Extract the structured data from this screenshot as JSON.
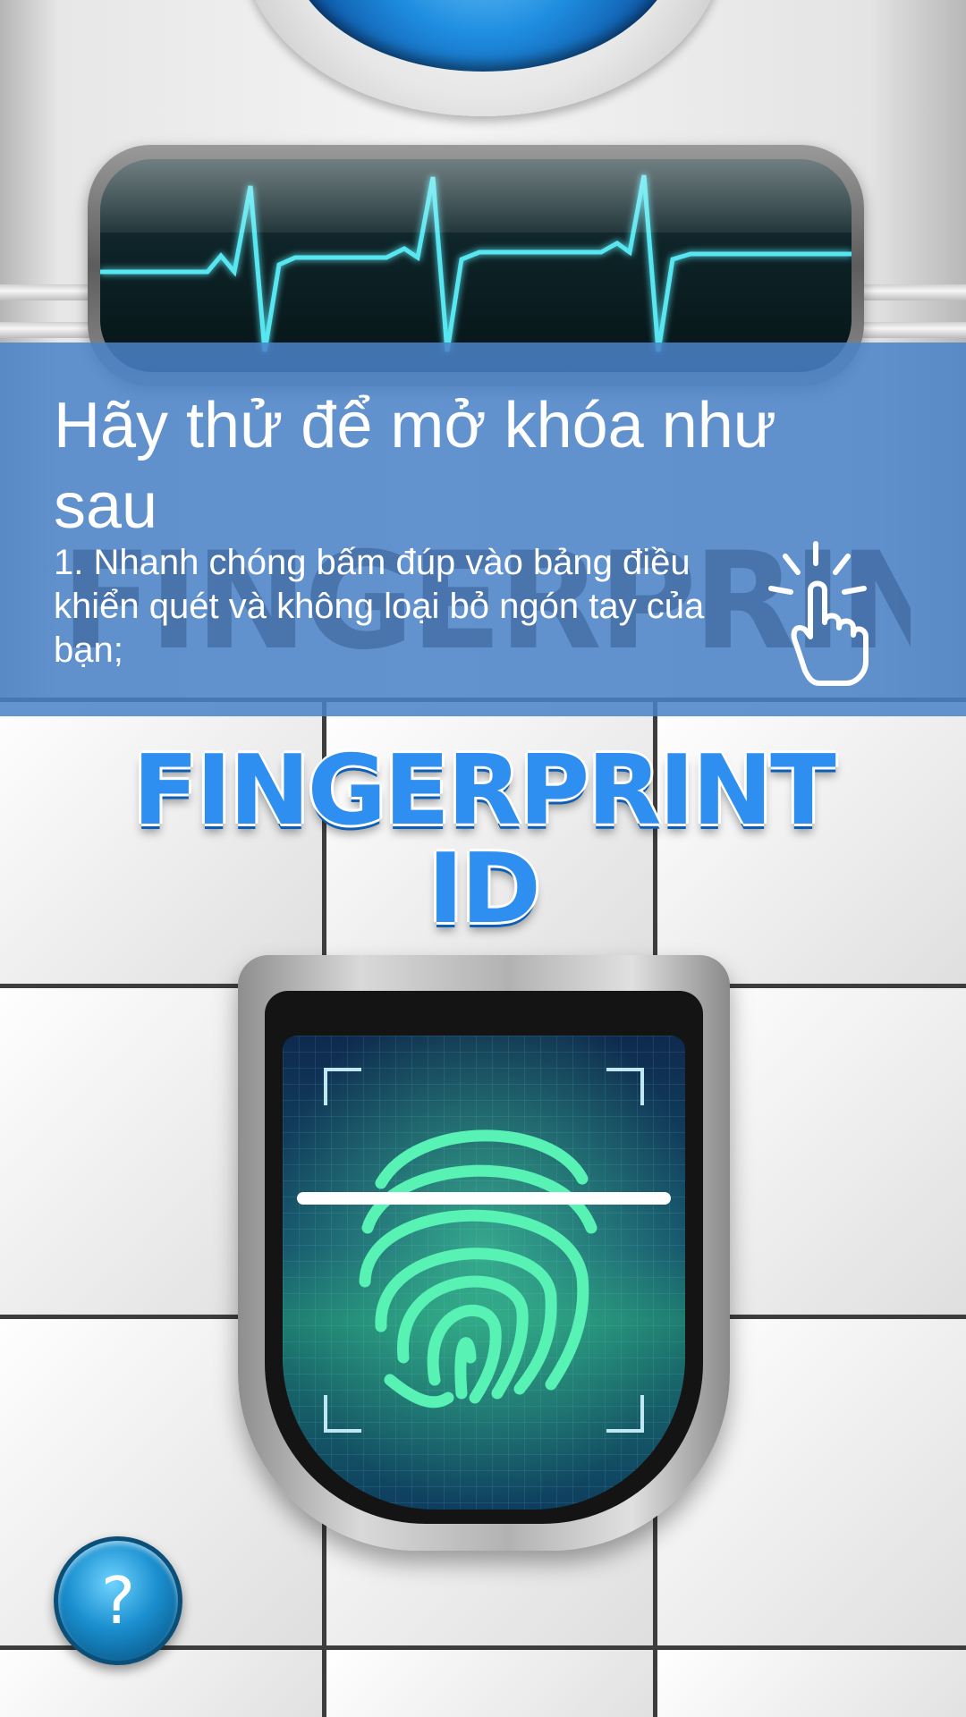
{
  "banner": {
    "title": "Hãy thử để mở khóa như sau",
    "body": "1. Nhanh chóng bấm đúp vào bảng điều khiển quét và không loại bỏ ngón tay của bạn;",
    "background_watermark": "FINGERPRINT LOCK"
  },
  "logo": {
    "text": "FINGERPRINT ID"
  },
  "help_button": {
    "label": "?"
  },
  "colors": {
    "banner_overlay": "#4a82c8",
    "logo_blue": "#2f8ff0",
    "scan_green": "#57f2b4",
    "heartbeat": "#58e6f0"
  },
  "icons": [
    "tap-hand-icon",
    "fingerprint-icon",
    "help-icon"
  ]
}
